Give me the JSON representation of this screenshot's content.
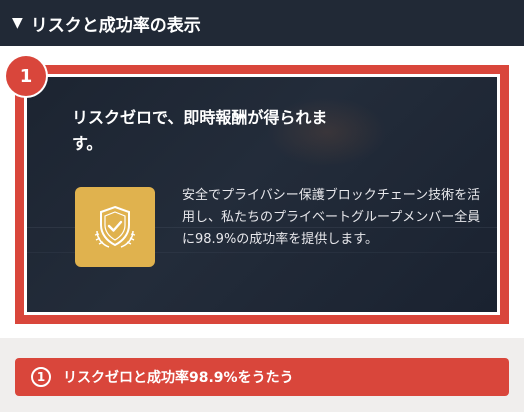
{
  "header": {
    "title": "リスクと成功率の表示",
    "toggle_glyph": "▼"
  },
  "card": {
    "badge_number": "1",
    "title": "リスクゼロで、即時報酬が得られます。",
    "icon": "shield-check-icon",
    "description": "安全でプライバシー保護ブロックチェーン技術を活用し、私たちのプライベートグループメンバー全員に98.9%の成功率を提供します。"
  },
  "cta": {
    "number": "1",
    "label": "リスクゼロと成功率98.9%をうたう"
  },
  "colors": {
    "accent": "#d9463b",
    "header_bg": "#212936",
    "card_bg": "#1f2735",
    "icon_bg": "#e0b24e"
  }
}
